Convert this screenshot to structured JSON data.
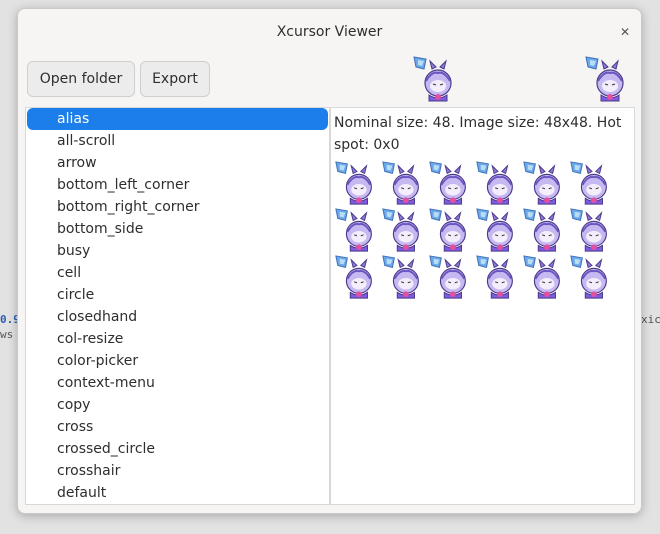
{
  "window": {
    "title": "Xcursor Viewer"
  },
  "toolbar": {
    "open_label": "Open folder",
    "export_label": "Export"
  },
  "detail": {
    "info": "Nominal size: 48. Image size: 48x48. Hot spot: 0x0"
  },
  "cursor_list": {
    "selected": "alias",
    "items": [
      "alias",
      "all-scroll",
      "arrow",
      "bottom_left_corner",
      "bottom_right_corner",
      "bottom_side",
      "busy",
      "cell",
      "circle",
      "closedhand",
      "col-resize",
      "color-picker",
      "context-menu",
      "copy",
      "cross",
      "crossed_circle",
      "crosshair",
      "default"
    ]
  },
  "background": {
    "left_text_1": "0.9",
    "left_text_2": "ws",
    "right_text_1": "xic"
  },
  "colors": {
    "accent": "#1c7eea",
    "sprite_purple": "#8e7ad8",
    "sprite_blue": "#6aa8e8"
  },
  "icons": {
    "close": "close-icon",
    "sprite": "cursor-sprite-icon"
  }
}
